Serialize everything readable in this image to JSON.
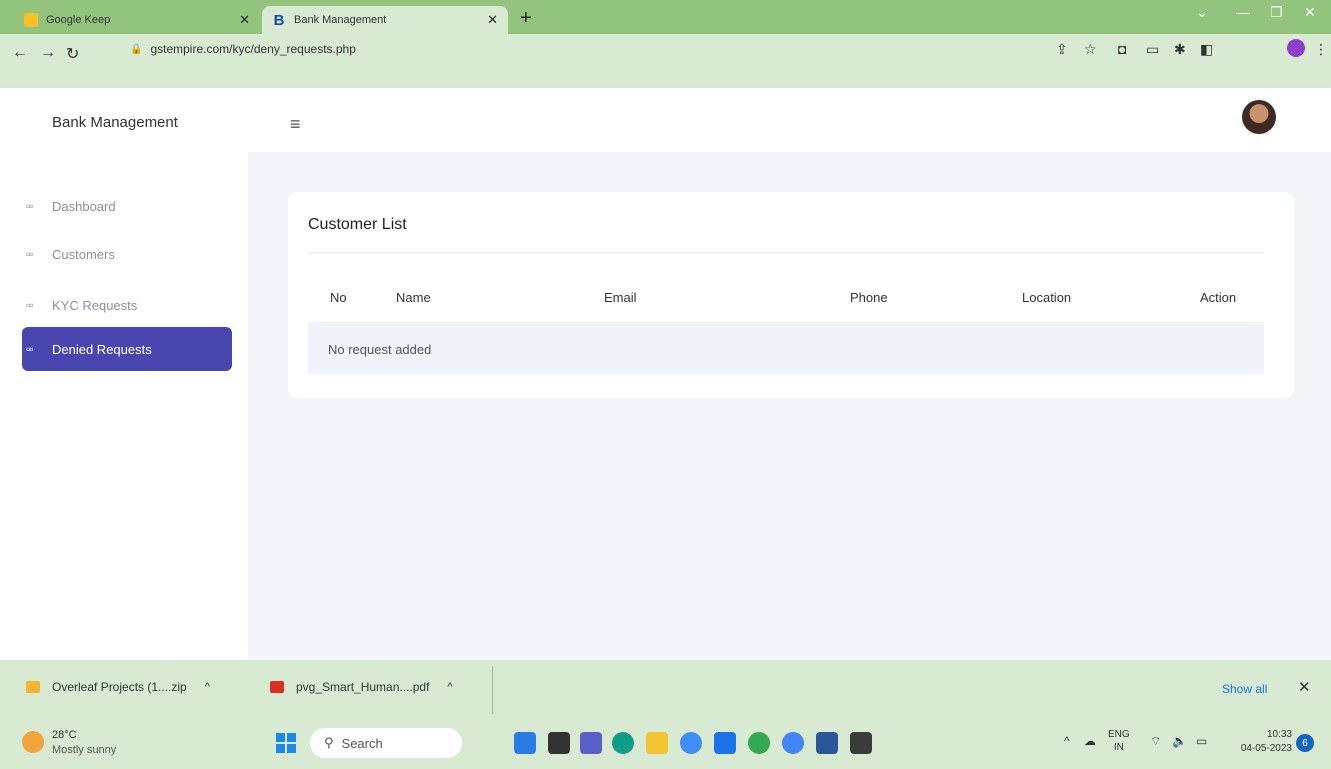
{
  "browser": {
    "tabs": [
      {
        "label": "Google Keep",
        "active": false
      },
      {
        "label": "Bank Management",
        "active": true
      }
    ],
    "url": "gstempire.com/kyc/deny_requests.php"
  },
  "app": {
    "brand": "Bank Management",
    "sidebar": {
      "items": [
        {
          "label": "Dashboard",
          "active": false
        },
        {
          "label": "Customers",
          "active": false
        },
        {
          "label": "KYC Requests",
          "active": false
        },
        {
          "label": "Denied Requests",
          "active": true
        }
      ]
    },
    "card": {
      "title": "Customer List",
      "columns": [
        "No",
        "Name",
        "Email",
        "Phone",
        "Location",
        "Action"
      ],
      "empty_message": "No request added"
    }
  },
  "downloads": {
    "items": [
      {
        "label": "Overleaf Projects (1....zip",
        "icon": "zip-folder-icon"
      },
      {
        "label": "pvg_Smart_Human....pdf",
        "icon": "pdf-icon"
      }
    ],
    "show_all": "Show all"
  },
  "taskbar": {
    "weather": {
      "temp": "28°C",
      "condition": "Mostly sunny"
    },
    "search_placeholder": "Search",
    "lang_line1": "ENG",
    "lang_line2": "IN",
    "time": "10:33",
    "date": "04-05-2023",
    "notification_count": "6"
  },
  "colors": {
    "accent": "#4a46b0",
    "chrome": "#93c47d",
    "main_bg": "#f3f5fb"
  }
}
